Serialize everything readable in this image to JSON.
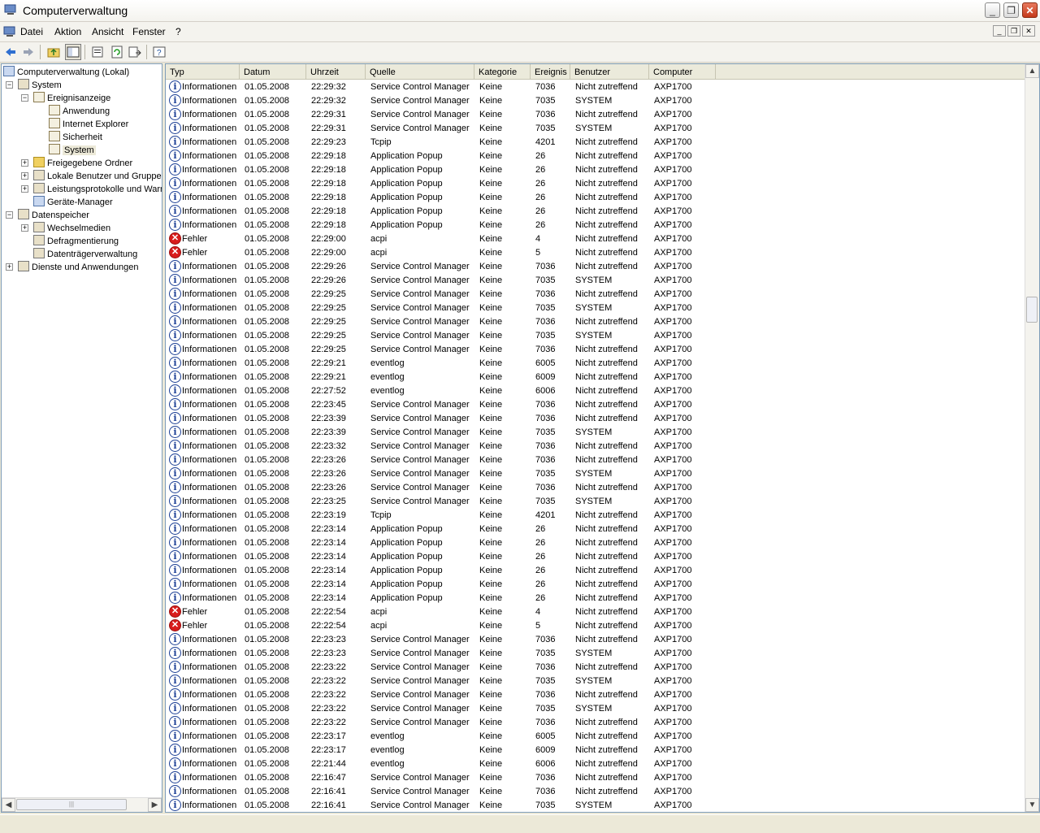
{
  "window": {
    "title": "Computerverwaltung"
  },
  "menu": [
    "Datei",
    "Aktion",
    "Ansicht",
    "Fenster",
    "?"
  ],
  "tree": {
    "root": "Computerverwaltung (Lokal)",
    "system": "System",
    "eventviewer": "Ereignisanzeige",
    "anwendung": "Anwendung",
    "ie": "Internet Explorer",
    "sicherheit": "Sicherheit",
    "system_log": "System",
    "shared": "Freigegebene Ordner",
    "users": "Lokale Benutzer und Gruppen",
    "perf": "Leistungsprotokolle und Warn",
    "devmgr": "Geräte-Manager",
    "storage": "Datenspeicher",
    "removable": "Wechselmedien",
    "defrag": "Defragmentierung",
    "diskmgmt": "Datenträgerverwaltung",
    "services": "Dienste und Anwendungen"
  },
  "columns": [
    "Typ",
    "Datum",
    "Uhrzeit",
    "Quelle",
    "Kategorie",
    "Ereignis",
    "Benutzer",
    "Computer"
  ],
  "events": [
    [
      "info",
      "Informationen",
      "01.05.2008",
      "22:29:32",
      "Service Control Manager",
      "Keine",
      "7036",
      "Nicht zutreffend",
      "AXP1700"
    ],
    [
      "info",
      "Informationen",
      "01.05.2008",
      "22:29:32",
      "Service Control Manager",
      "Keine",
      "7035",
      "SYSTEM",
      "AXP1700"
    ],
    [
      "info",
      "Informationen",
      "01.05.2008",
      "22:29:31",
      "Service Control Manager",
      "Keine",
      "7036",
      "Nicht zutreffend",
      "AXP1700"
    ],
    [
      "info",
      "Informationen",
      "01.05.2008",
      "22:29:31",
      "Service Control Manager",
      "Keine",
      "7035",
      "SYSTEM",
      "AXP1700"
    ],
    [
      "info",
      "Informationen",
      "01.05.2008",
      "22:29:23",
      "Tcpip",
      "Keine",
      "4201",
      "Nicht zutreffend",
      "AXP1700"
    ],
    [
      "info",
      "Informationen",
      "01.05.2008",
      "22:29:18",
      "Application Popup",
      "Keine",
      "26",
      "Nicht zutreffend",
      "AXP1700"
    ],
    [
      "info",
      "Informationen",
      "01.05.2008",
      "22:29:18",
      "Application Popup",
      "Keine",
      "26",
      "Nicht zutreffend",
      "AXP1700"
    ],
    [
      "info",
      "Informationen",
      "01.05.2008",
      "22:29:18",
      "Application Popup",
      "Keine",
      "26",
      "Nicht zutreffend",
      "AXP1700"
    ],
    [
      "info",
      "Informationen",
      "01.05.2008",
      "22:29:18",
      "Application Popup",
      "Keine",
      "26",
      "Nicht zutreffend",
      "AXP1700"
    ],
    [
      "info",
      "Informationen",
      "01.05.2008",
      "22:29:18",
      "Application Popup",
      "Keine",
      "26",
      "Nicht zutreffend",
      "AXP1700"
    ],
    [
      "info",
      "Informationen",
      "01.05.2008",
      "22:29:18",
      "Application Popup",
      "Keine",
      "26",
      "Nicht zutreffend",
      "AXP1700"
    ],
    [
      "err",
      "Fehler",
      "01.05.2008",
      "22:29:00",
      "acpi",
      "Keine",
      "4",
      "Nicht zutreffend",
      "AXP1700"
    ],
    [
      "err",
      "Fehler",
      "01.05.2008",
      "22:29:00",
      "acpi",
      "Keine",
      "5",
      "Nicht zutreffend",
      "AXP1700"
    ],
    [
      "info",
      "Informationen",
      "01.05.2008",
      "22:29:26",
      "Service Control Manager",
      "Keine",
      "7036",
      "Nicht zutreffend",
      "AXP1700"
    ],
    [
      "info",
      "Informationen",
      "01.05.2008",
      "22:29:26",
      "Service Control Manager",
      "Keine",
      "7035",
      "SYSTEM",
      "AXP1700"
    ],
    [
      "info",
      "Informationen",
      "01.05.2008",
      "22:29:25",
      "Service Control Manager",
      "Keine",
      "7036",
      "Nicht zutreffend",
      "AXP1700"
    ],
    [
      "info",
      "Informationen",
      "01.05.2008",
      "22:29:25",
      "Service Control Manager",
      "Keine",
      "7035",
      "SYSTEM",
      "AXP1700"
    ],
    [
      "info",
      "Informationen",
      "01.05.2008",
      "22:29:25",
      "Service Control Manager",
      "Keine",
      "7036",
      "Nicht zutreffend",
      "AXP1700"
    ],
    [
      "info",
      "Informationen",
      "01.05.2008",
      "22:29:25",
      "Service Control Manager",
      "Keine",
      "7035",
      "SYSTEM",
      "AXP1700"
    ],
    [
      "info",
      "Informationen",
      "01.05.2008",
      "22:29:25",
      "Service Control Manager",
      "Keine",
      "7036",
      "Nicht zutreffend",
      "AXP1700"
    ],
    [
      "info",
      "Informationen",
      "01.05.2008",
      "22:29:21",
      "eventlog",
      "Keine",
      "6005",
      "Nicht zutreffend",
      "AXP1700"
    ],
    [
      "info",
      "Informationen",
      "01.05.2008",
      "22:29:21",
      "eventlog",
      "Keine",
      "6009",
      "Nicht zutreffend",
      "AXP1700"
    ],
    [
      "info",
      "Informationen",
      "01.05.2008",
      "22:27:52",
      "eventlog",
      "Keine",
      "6006",
      "Nicht zutreffend",
      "AXP1700"
    ],
    [
      "info",
      "Informationen",
      "01.05.2008",
      "22:23:45",
      "Service Control Manager",
      "Keine",
      "7036",
      "Nicht zutreffend",
      "AXP1700"
    ],
    [
      "info",
      "Informationen",
      "01.05.2008",
      "22:23:39",
      "Service Control Manager",
      "Keine",
      "7036",
      "Nicht zutreffend",
      "AXP1700"
    ],
    [
      "info",
      "Informationen",
      "01.05.2008",
      "22:23:39",
      "Service Control Manager",
      "Keine",
      "7035",
      "SYSTEM",
      "AXP1700"
    ],
    [
      "info",
      "Informationen",
      "01.05.2008",
      "22:23:32",
      "Service Control Manager",
      "Keine",
      "7036",
      "Nicht zutreffend",
      "AXP1700"
    ],
    [
      "info",
      "Informationen",
      "01.05.2008",
      "22:23:26",
      "Service Control Manager",
      "Keine",
      "7036",
      "Nicht zutreffend",
      "AXP1700"
    ],
    [
      "info",
      "Informationen",
      "01.05.2008",
      "22:23:26",
      "Service Control Manager",
      "Keine",
      "7035",
      "SYSTEM",
      "AXP1700"
    ],
    [
      "info",
      "Informationen",
      "01.05.2008",
      "22:23:26",
      "Service Control Manager",
      "Keine",
      "7036",
      "Nicht zutreffend",
      "AXP1700"
    ],
    [
      "info",
      "Informationen",
      "01.05.2008",
      "22:23:25",
      "Service Control Manager",
      "Keine",
      "7035",
      "SYSTEM",
      "AXP1700"
    ],
    [
      "info",
      "Informationen",
      "01.05.2008",
      "22:23:19",
      "Tcpip",
      "Keine",
      "4201",
      "Nicht zutreffend",
      "AXP1700"
    ],
    [
      "info",
      "Informationen",
      "01.05.2008",
      "22:23:14",
      "Application Popup",
      "Keine",
      "26",
      "Nicht zutreffend",
      "AXP1700"
    ],
    [
      "info",
      "Informationen",
      "01.05.2008",
      "22:23:14",
      "Application Popup",
      "Keine",
      "26",
      "Nicht zutreffend",
      "AXP1700"
    ],
    [
      "info",
      "Informationen",
      "01.05.2008",
      "22:23:14",
      "Application Popup",
      "Keine",
      "26",
      "Nicht zutreffend",
      "AXP1700"
    ],
    [
      "info",
      "Informationen",
      "01.05.2008",
      "22:23:14",
      "Application Popup",
      "Keine",
      "26",
      "Nicht zutreffend",
      "AXP1700"
    ],
    [
      "info",
      "Informationen",
      "01.05.2008",
      "22:23:14",
      "Application Popup",
      "Keine",
      "26",
      "Nicht zutreffend",
      "AXP1700"
    ],
    [
      "info",
      "Informationen",
      "01.05.2008",
      "22:23:14",
      "Application Popup",
      "Keine",
      "26",
      "Nicht zutreffend",
      "AXP1700"
    ],
    [
      "err",
      "Fehler",
      "01.05.2008",
      "22:22:54",
      "acpi",
      "Keine",
      "4",
      "Nicht zutreffend",
      "AXP1700"
    ],
    [
      "err",
      "Fehler",
      "01.05.2008",
      "22:22:54",
      "acpi",
      "Keine",
      "5",
      "Nicht zutreffend",
      "AXP1700"
    ],
    [
      "info",
      "Informationen",
      "01.05.2008",
      "22:23:23",
      "Service Control Manager",
      "Keine",
      "7036",
      "Nicht zutreffend",
      "AXP1700"
    ],
    [
      "info",
      "Informationen",
      "01.05.2008",
      "22:23:23",
      "Service Control Manager",
      "Keine",
      "7035",
      "SYSTEM",
      "AXP1700"
    ],
    [
      "info",
      "Informationen",
      "01.05.2008",
      "22:23:22",
      "Service Control Manager",
      "Keine",
      "7036",
      "Nicht zutreffend",
      "AXP1700"
    ],
    [
      "info",
      "Informationen",
      "01.05.2008",
      "22:23:22",
      "Service Control Manager",
      "Keine",
      "7035",
      "SYSTEM",
      "AXP1700"
    ],
    [
      "info",
      "Informationen",
      "01.05.2008",
      "22:23:22",
      "Service Control Manager",
      "Keine",
      "7036",
      "Nicht zutreffend",
      "AXP1700"
    ],
    [
      "info",
      "Informationen",
      "01.05.2008",
      "22:23:22",
      "Service Control Manager",
      "Keine",
      "7035",
      "SYSTEM",
      "AXP1700"
    ],
    [
      "info",
      "Informationen",
      "01.05.2008",
      "22:23:22",
      "Service Control Manager",
      "Keine",
      "7036",
      "Nicht zutreffend",
      "AXP1700"
    ],
    [
      "info",
      "Informationen",
      "01.05.2008",
      "22:23:17",
      "eventlog",
      "Keine",
      "6005",
      "Nicht zutreffend",
      "AXP1700"
    ],
    [
      "info",
      "Informationen",
      "01.05.2008",
      "22:23:17",
      "eventlog",
      "Keine",
      "6009",
      "Nicht zutreffend",
      "AXP1700"
    ],
    [
      "info",
      "Informationen",
      "01.05.2008",
      "22:21:44",
      "eventlog",
      "Keine",
      "6006",
      "Nicht zutreffend",
      "AXP1700"
    ],
    [
      "info",
      "Informationen",
      "01.05.2008",
      "22:16:47",
      "Service Control Manager",
      "Keine",
      "7036",
      "Nicht zutreffend",
      "AXP1700"
    ],
    [
      "info",
      "Informationen",
      "01.05.2008",
      "22:16:41",
      "Service Control Manager",
      "Keine",
      "7036",
      "Nicht zutreffend",
      "AXP1700"
    ],
    [
      "info",
      "Informationen",
      "01.05.2008",
      "22:16:41",
      "Service Control Manager",
      "Keine",
      "7035",
      "SYSTEM",
      "AXP1700"
    ]
  ]
}
